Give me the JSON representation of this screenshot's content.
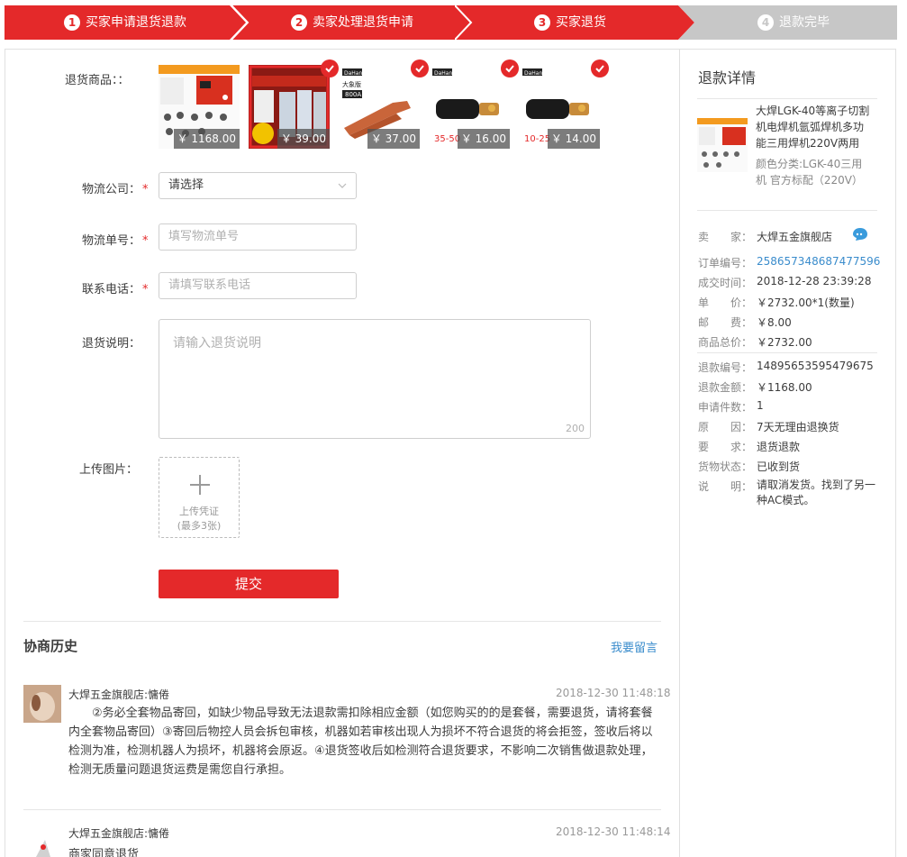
{
  "steps": [
    {
      "num": "1",
      "label": "买家申请退货退款",
      "active": true
    },
    {
      "num": "2",
      "label": "卖家处理退货申请",
      "active": true
    },
    {
      "num": "3",
      "label": "买家退货",
      "active": true
    },
    {
      "num": "4",
      "label": "退款完毕",
      "active": false
    }
  ],
  "colors": {
    "accent": "#e4292a",
    "link": "#3a8ccc",
    "inactive_step": "#c7c7c7"
  },
  "form": {
    "products_label": "退货商品：：",
    "products": [
      {
        "price": "￥ 1168.00",
        "checked": false,
        "name": "welder-machine"
      },
      {
        "price": "￥ 39.00",
        "checked": true,
        "name": "welding-set-package"
      },
      {
        "price": "￥ 37.00",
        "checked": true,
        "name": "electrode-holder",
        "badge": "大象版 800A",
        "brand": "DaHan"
      },
      {
        "price": "￥ 16.00",
        "checked": true,
        "name": "cable-connector-35-50",
        "spec": "35-50",
        "brand": "DaHan"
      },
      {
        "price": "￥ 14.00",
        "checked": true,
        "name": "cable-connector-10-25",
        "spec": "10-25",
        "brand": "DaHan"
      }
    ],
    "logistics_label": "物流公司：",
    "logistics_value": "请选择",
    "tracking_label": "物流单号：",
    "tracking_placeholder": "填写物流单号",
    "phone_label": "联系电话：",
    "phone_placeholder": "请填写联系电话",
    "note_label": "退货说明：",
    "note_placeholder": "请输入退货说明",
    "note_count": "200",
    "upload_label": "上传图片：",
    "upload_text1": "上传凭证",
    "upload_text2": "(最多3张)",
    "submit_label": "提交"
  },
  "history": {
    "title": "协商历史",
    "leave_message": "我要留言",
    "messages": [
      {
        "name": "大焊五金旗舰店:慵倦",
        "time": "2018-12-30 11:48:18",
        "body": "②务必全套物品寄回，如缺少物品导致无法退款需扣除相应金额（如您购买的的是套餐，需要退货，请将套餐内全套物品寄回）③寄回后物控人员会拆包审核，机器如若审核出现人为损坏不符合退货的将会拒签，签收后将以检测为准，检测机器人为损坏，机器将会原返。④退货签收后如检测符合退货要求，不影响二次销售做退款处理，检测无质量问题退货运费是需您自行承担。"
      },
      {
        "name": "大焊五金旗舰店:慵倦",
        "time": "2018-12-30 11:48:14",
        "body": "商家同意退货"
      }
    ]
  },
  "sidebar": {
    "title": "退款详情",
    "item_title": "大焊LGK-40等离子切割机电焊机氩弧焊机多功能三用焊机220V两用",
    "item_spec": "颜色分类:LGK-40三用机 官方标配（220V）",
    "seller_label": "卖　　家：",
    "seller": "大焊五金旗舰店",
    "order_info": [
      {
        "k": "订单编号：",
        "v": "258657348687477596",
        "link": true
      },
      {
        "k": "成交时间：",
        "v": "2018-12-28 23:39:28"
      },
      {
        "k": "单　　价：",
        "v": "￥2732.00*1(数量)"
      },
      {
        "k": "邮　　费：",
        "v": "￥8.00"
      },
      {
        "k": "商品总价：",
        "v": "￥2732.00"
      }
    ],
    "refund_info": [
      {
        "k": "退款编号：",
        "v": "14895653595479675"
      },
      {
        "k": "退款金额：",
        "v": "￥1168.00"
      },
      {
        "k": "申请件数：",
        "v": "1"
      },
      {
        "k": "原　　因：",
        "v": "7天无理由退换货"
      },
      {
        "k": "要　　求：",
        "v": "退货退款"
      },
      {
        "k": "货物状态：",
        "v": "已收到货"
      }
    ],
    "note_label": "说　　明：",
    "note": "请取消发货。找到了另一种AC模式。"
  }
}
